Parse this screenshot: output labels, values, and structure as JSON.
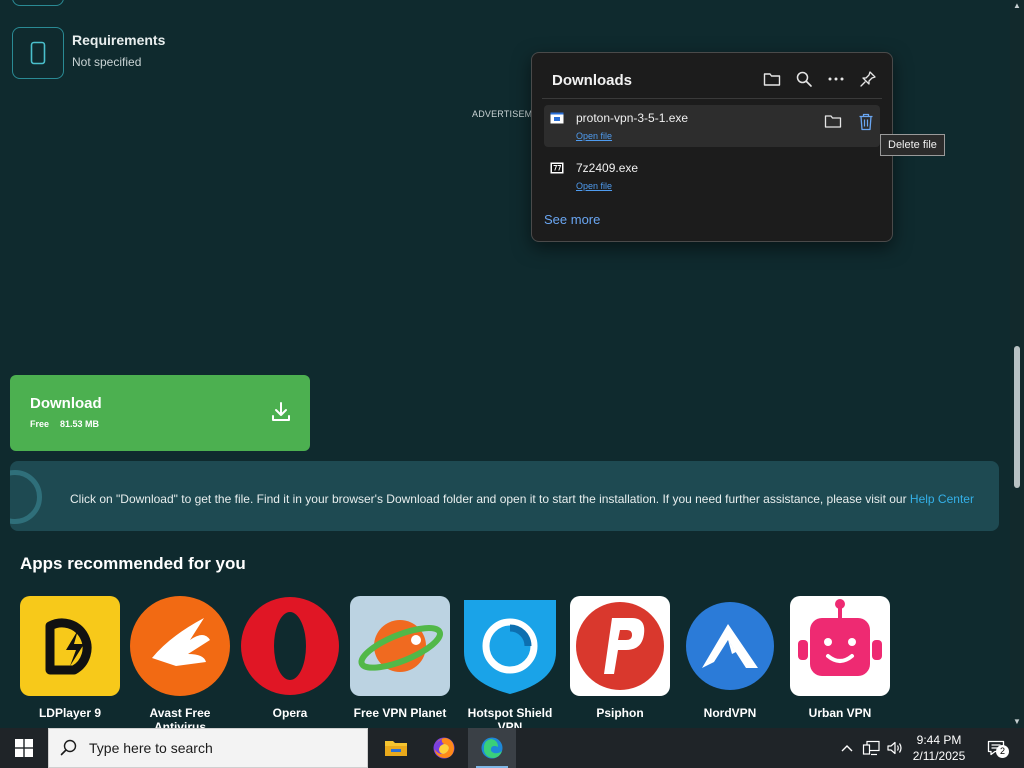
{
  "requirements": {
    "title": "Requirements",
    "value": "Not specified"
  },
  "advertisement": "ADVERTISEMENT",
  "download_button": {
    "label": "Download",
    "price": "Free",
    "size": "81.53 MB"
  },
  "info_banner": {
    "text": "Click on \"Download\" to get the file. Find it in your browser's Download folder and open it to start the installation. If you need further assistance, please visit our ",
    "link": "Help Center"
  },
  "recommended": {
    "title": "Apps recommended for you",
    "apps": [
      {
        "name": "LDPlayer 9",
        "icon": "ldplayer-icon"
      },
      {
        "name": "Avast Free Antivirus",
        "icon": "avast-icon"
      },
      {
        "name": "Opera",
        "icon": "opera-icon"
      },
      {
        "name": "Free VPN Planet",
        "icon": "vpn-planet-icon"
      },
      {
        "name": "Hotspot Shield VPN",
        "icon": "hotspot-shield-icon"
      },
      {
        "name": "Psiphon",
        "icon": "psiphon-icon"
      },
      {
        "name": "NordVPN",
        "icon": "nordvpn-icon"
      },
      {
        "name": "Urban VPN",
        "icon": "urban-vpn-icon"
      }
    ]
  },
  "downloads_panel": {
    "title": "Downloads",
    "items": [
      {
        "name": "proton-vpn-3-5-1.exe",
        "action": "Open file"
      },
      {
        "name": "7z2409.exe",
        "action": "Open file"
      }
    ],
    "see_more": "See more",
    "tooltip": "Delete file"
  },
  "taskbar": {
    "search_placeholder": "Type here to search",
    "time": "9:44 PM",
    "date": "2/11/2025",
    "notification_count": "2"
  },
  "colors": {
    "page_bg": "#0f2a2e",
    "download_green": "#4cb050",
    "banner_bg": "#1e4a52",
    "link_blue": "#34b0e8"
  }
}
